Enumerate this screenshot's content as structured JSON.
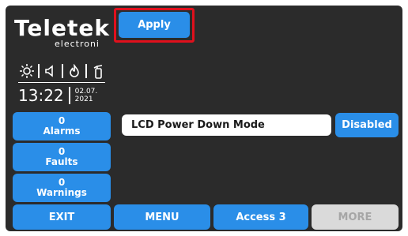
{
  "header": {
    "apply_label": "Apply"
  },
  "logo": {
    "main": "Teletek",
    "sub": "electroni"
  },
  "status_icons": [
    "sun-icon",
    "speaker-icon",
    "flame-icon",
    "extinguisher-icon"
  ],
  "clock": {
    "time": "13:22",
    "date_day_month": "02.07.",
    "date_year": "2021"
  },
  "counters": {
    "alarms": {
      "count": "0",
      "label": "Alarms"
    },
    "faults": {
      "count": "0",
      "label": "Faults"
    },
    "warnings": {
      "count": "0",
      "label": "Warnings"
    }
  },
  "setting": {
    "label": "LCD Power Down Mode",
    "value": "Disabled"
  },
  "footer": {
    "exit": "EXIT",
    "menu": "MENU",
    "access": "Access 3",
    "more": "MORE"
  },
  "colors": {
    "button_blue": "#2a8ee8",
    "highlight_red": "#e0101c",
    "panel_bg": "#2b2b2b",
    "disabled_bg": "#dadada"
  }
}
